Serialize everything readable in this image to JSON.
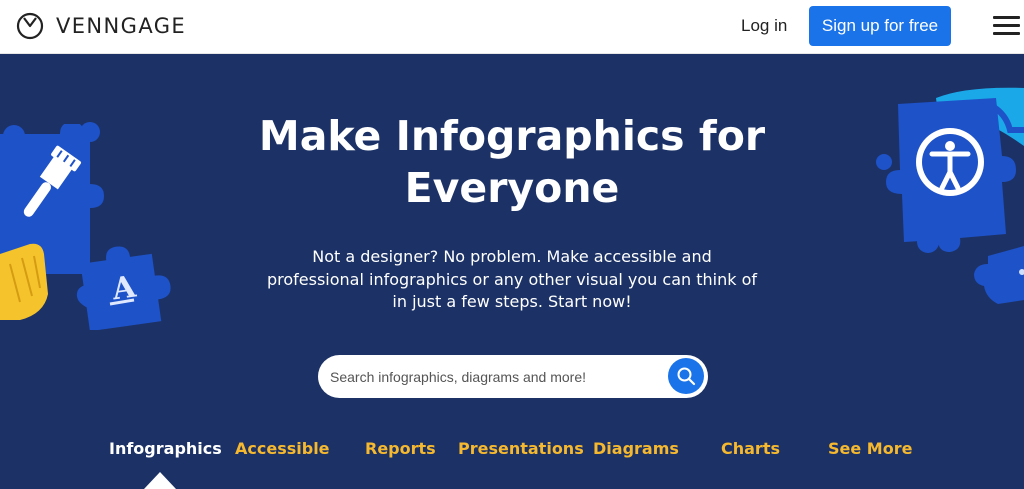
{
  "header": {
    "brand": "VENNGAGE",
    "login_label": "Log in",
    "signup_label": "Sign up for free",
    "menu_icon": "hamburger-menu-icon"
  },
  "hero": {
    "headline_line1": "Make Infographics for",
    "headline_line2": "Everyone",
    "subtext_line1": "Not a designer? No problem. Make accessible and",
    "subtext_line2": "professional infographics or any other visual you can think of",
    "subtext_line3": "in just a few steps. Start now!",
    "search": {
      "placeholder": "Search infographics, diagrams and more!",
      "value": "",
      "icon": "search-icon"
    },
    "tabs": [
      {
        "label": "Infographics",
        "active": true
      },
      {
        "label": "Accessible",
        "active": false
      },
      {
        "label": "Reports",
        "active": false
      },
      {
        "label": "Presentations",
        "active": false
      },
      {
        "label": "Diagrams",
        "active": false
      },
      {
        "label": "Charts",
        "active": false
      },
      {
        "label": "See More",
        "active": false
      }
    ],
    "decorations": {
      "left_icons": [
        "paintbrush-icon",
        "text-format-icon"
      ],
      "right_icons": [
        "accessibility-icon"
      ]
    }
  },
  "colors": {
    "hero_background": "#1c3266",
    "accent_blue": "#1a73e8",
    "tab_yellow": "#f5b82e",
    "puzzle_blue": "#1e52c8",
    "highlight_yellow": "#f5c32c"
  }
}
